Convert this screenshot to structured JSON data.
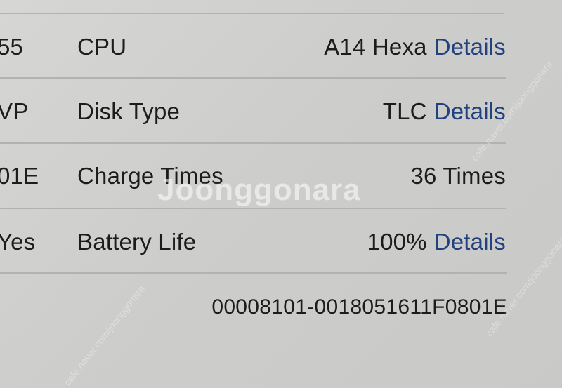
{
  "rows": [
    {
      "left_fragment": "55",
      "label": "CPU",
      "value": "A14 Hexa",
      "link": "Details"
    },
    {
      "left_fragment": "VP",
      "label": "Disk Type",
      "value": "TLC",
      "link": "Details"
    },
    {
      "left_fragment": "01E",
      "label": "Charge Times",
      "value": "36 Times",
      "link": ""
    },
    {
      "left_fragment": "Yes",
      "label": "Battery Life",
      "value": "100%",
      "link": "Details"
    }
  ],
  "serial": "00008101-0018051611F0801E",
  "watermark": {
    "main": "Joonggonara",
    "faint": "cafe.naver.com/joonggonara"
  },
  "colors": {
    "background": "#cfcfcd",
    "text": "#1c1c1c",
    "link": "#23417e",
    "divider": "#b2b2b0"
  }
}
